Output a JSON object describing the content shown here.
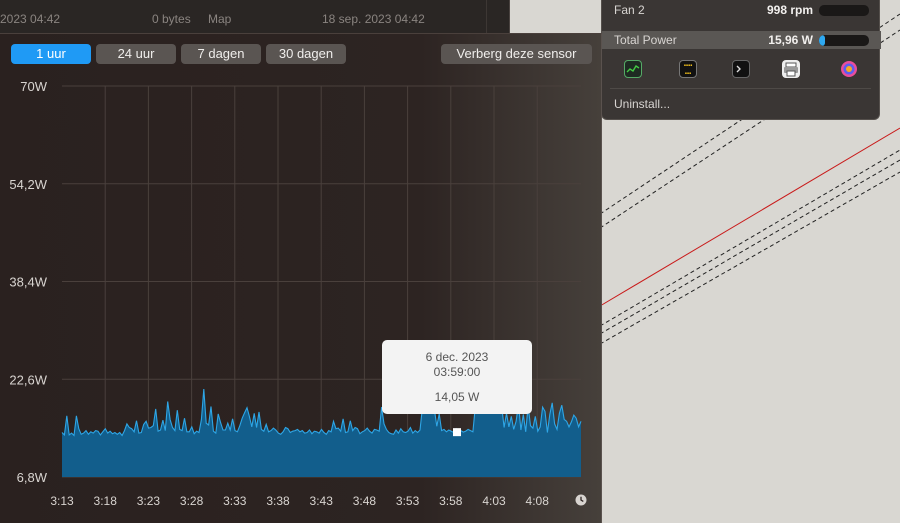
{
  "finder": {
    "date_left": "2023 04:42",
    "size": "0 bytes",
    "kind": "Map",
    "date_right": "18 sep. 2023 04:42"
  },
  "popup": {
    "fan_label": "Fan 2",
    "fan_value": "998 rpm",
    "power_label": "Total Power",
    "power_value": "15,96 W",
    "power_fill": 0.12,
    "uninstall_label": "Uninstall...",
    "icons": [
      "activity-monitor-icon",
      "widgets-app-icon",
      "terminal-icon",
      "printer-app-icon",
      "color-app-icon"
    ]
  },
  "tabs": [
    {
      "label": "1 uur",
      "active": true
    },
    {
      "label": "24 uur",
      "active": false
    },
    {
      "label": "7 dagen",
      "active": false
    },
    {
      "label": "30 dagen",
      "active": false
    }
  ],
  "hide_sensor_label": "Verberg deze sensor",
  "tooltip": {
    "date": "6 dec. 2023",
    "time": "03:59:00",
    "value": "14,05 W"
  },
  "colors": {
    "accent": "#1f9af5",
    "area_fill": "#125e8c",
    "area_line": "#2ea6e6"
  },
  "chart_data": {
    "type": "area",
    "title": "",
    "xlabel": "",
    "ylabel": "",
    "y_ticks": [
      "70W",
      "54,2W",
      "38,4W",
      "22,6W",
      "6,8W"
    ],
    "y_tick_values": [
      70,
      54.2,
      38.4,
      22.6,
      6.8
    ],
    "ylim": [
      6.8,
      70
    ],
    "x_ticks": [
      "3:13",
      "3:18",
      "3:23",
      "3:28",
      "3:33",
      "3:38",
      "3:43",
      "3:48",
      "3:53",
      "3:58",
      "4:03",
      "4:08"
    ],
    "grid": true,
    "series": [
      {
        "values": [
          14.0,
          13.6,
          16.7,
          13.6,
          13.9,
          13.5,
          16.7,
          14.6,
          13.7,
          13.9,
          14.3,
          13.7,
          14.1,
          13.9,
          14.3,
          14.2,
          13.6,
          14.1,
          14.6,
          13.9,
          14.2,
          13.8,
          14.0,
          13.7,
          14.0,
          13.5,
          14.3,
          15.4,
          14.8,
          14.6,
          14.1,
          15.9,
          13.9,
          14.0,
          15.3,
          15.8,
          14.7,
          14.8,
          15.1,
          17.8,
          14.2,
          14.4,
          16.0,
          14.3,
          19.0,
          16.1,
          14.8,
          14.3,
          17.6,
          14.5,
          14.3,
          16.3,
          14.1,
          14.1,
          14.9,
          13.8,
          14.2,
          14.0,
          16.1,
          21.0,
          15.5,
          15.2,
          18.2,
          14.2,
          13.9,
          17.0,
          15.6,
          14.4,
          14.4,
          15.5,
          14.4,
          16.2,
          14.3,
          14.1,
          15.1,
          16.3,
          17.2,
          18.0,
          16.6,
          14.9,
          17.1,
          14.8,
          17.3,
          14.5,
          14.2,
          15.3,
          14.1,
          14.3,
          14.7,
          14.4,
          13.9,
          13.7,
          14.1,
          14.8,
          14.6,
          14.0,
          14.2,
          14.3,
          14.5,
          14.1,
          14.3,
          13.9,
          14.0,
          14.4,
          13.8,
          14.2,
          14.1,
          13.9,
          14.5,
          14.0,
          13.7,
          14.3,
          14.1,
          15.8,
          14.6,
          14.7,
          14.2,
          16.2,
          14.0,
          14.1,
          15.9,
          14.3,
          14.8,
          14.6,
          13.8,
          14.1,
          14.3,
          14.7,
          14.2,
          13.9,
          14.5,
          14.4,
          14.2,
          18.1,
          15.4,
          14.5,
          14.0,
          13.8,
          13.7,
          14.4,
          13.9,
          14.6,
          14.1,
          14.0,
          14.2,
          14.8,
          13.9,
          14.3,
          14.0,
          14.4,
          18.0,
          17.8,
          17.9,
          17.8,
          18.1,
          17.7,
          15.0,
          17.0,
          14.3,
          14.5,
          14.1,
          14.4,
          14.2,
          14.0,
          14.6,
          14.1,
          14.3,
          14.05,
          14.2,
          14.5,
          14.3,
          14.1,
          18.2,
          18.0,
          17.9,
          18.1,
          17.8,
          18.0,
          17.7,
          18.2,
          17.9,
          18.1,
          18.0,
          18.2,
          14.8,
          17.1,
          14.9,
          16.6,
          14.5,
          15.8,
          18.5,
          14.4,
          16.9,
          14.1,
          18.3,
          15.1,
          14.7,
          16.6,
          14.2,
          14.9,
          18.1,
          17.4,
          14.0,
          16.9,
          18.8,
          15.4,
          14.5,
          17.1,
          18.4,
          16.1,
          15.8,
          14.9,
          15.7,
          16.8,
          16.3,
          14.9,
          15.8
        ]
      }
    ]
  }
}
